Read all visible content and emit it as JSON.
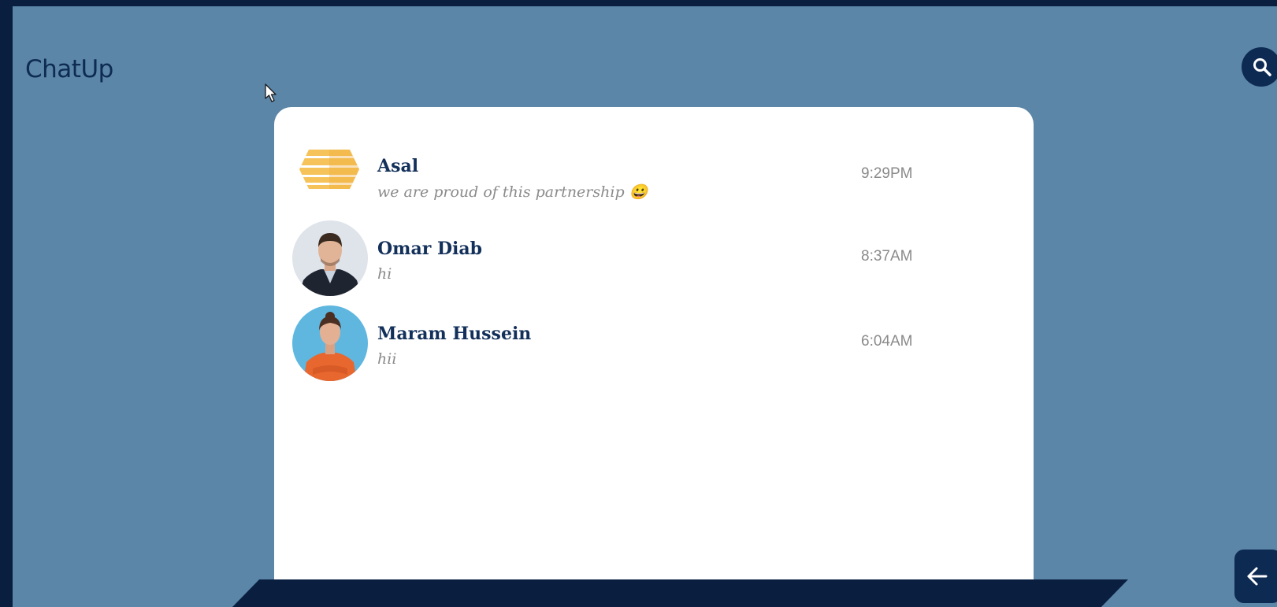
{
  "app": {
    "title": "ChatUp"
  },
  "toolbar": {
    "search_icon": "search-icon",
    "back_icon": "arrow-left-icon"
  },
  "colors": {
    "frame": "#0a1f3f",
    "background": "#5b86a8",
    "panel": "#ffffff",
    "accent": "#0d2a52",
    "name": "#13305a",
    "muted": "#8b8b8b"
  },
  "chats": [
    {
      "name": "Asal",
      "message": "we are proud of this partnership 😀",
      "time": "9:29PM",
      "avatar": "hexagon-logo"
    },
    {
      "name": "Omar Diab",
      "message": "hi",
      "time": "8:37AM",
      "avatar": "man-portrait"
    },
    {
      "name": "Maram Hussein",
      "message": "hii",
      "time": "6:04AM",
      "avatar": "woman-portrait"
    }
  ]
}
